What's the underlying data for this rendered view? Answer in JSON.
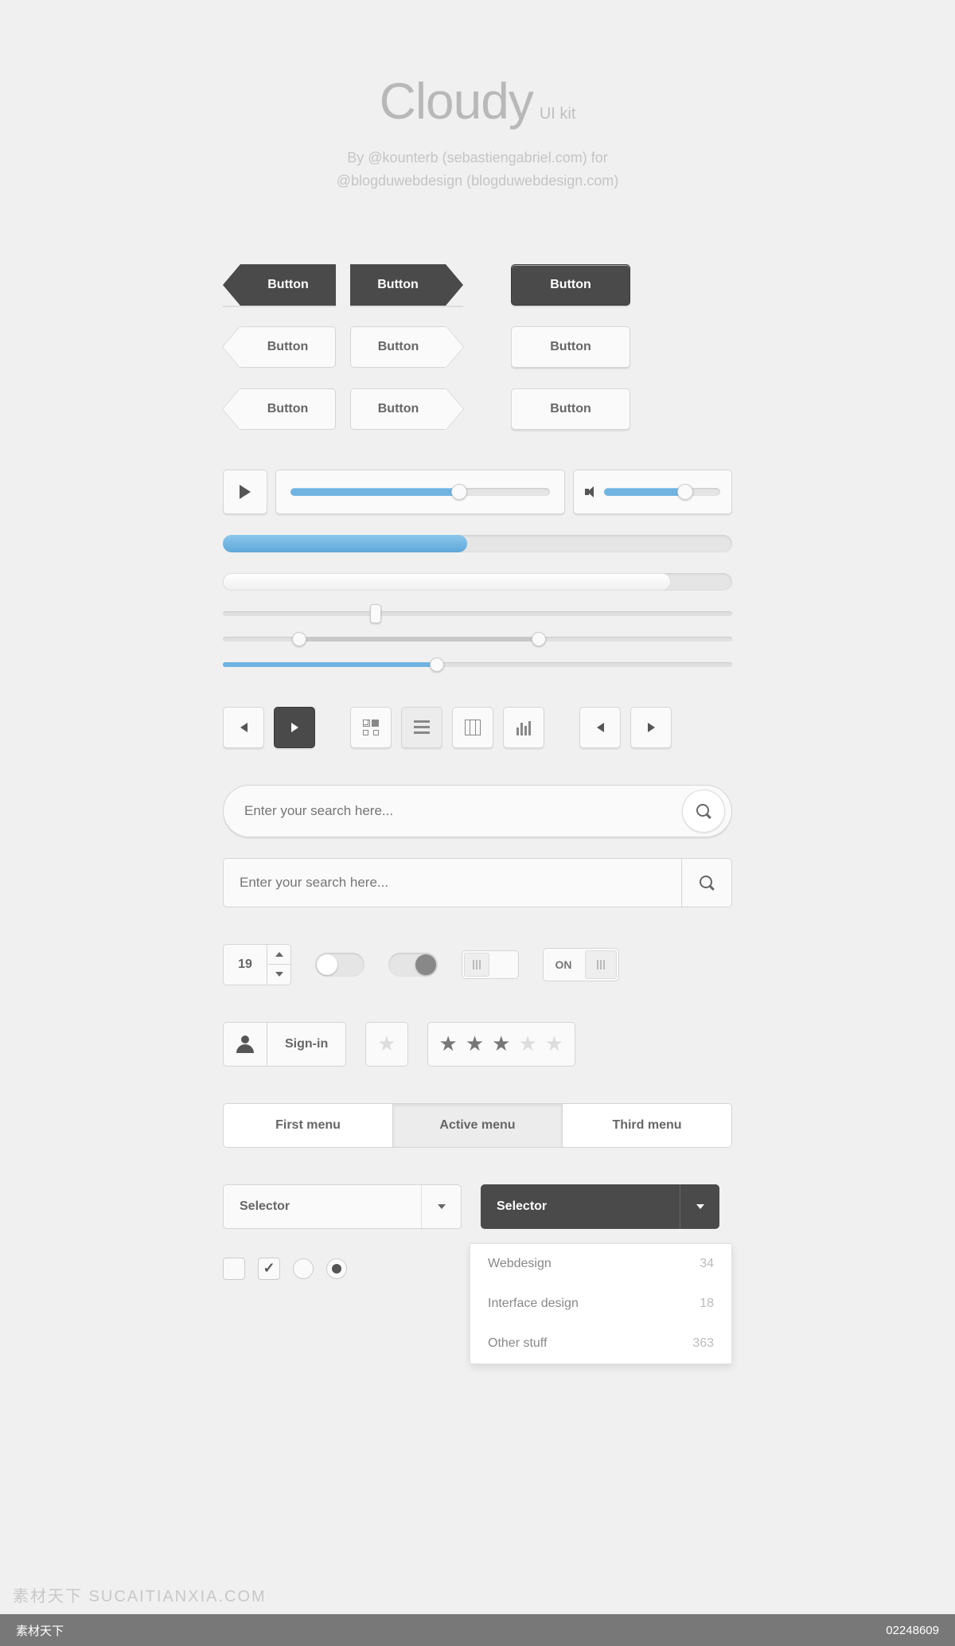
{
  "header": {
    "title": "Cloudy",
    "subtitle": "UI kit",
    "byline1": "By @kounterb (sebastiengabriel.com) for",
    "byline2": "@blogduwebdesign (blogduwebdesign.com)"
  },
  "buttons": {
    "dark_arrow_left": "Button",
    "dark_arrow_right": "Button",
    "dark_std": "Button",
    "light_arrow_left_1": "Button",
    "light_arrow_right_1": "Button",
    "light_std_1": "Button",
    "light_arrow_left_2": "Button",
    "light_arrow_right_2": "Button",
    "light_std_2": "Button"
  },
  "player": {
    "seek_percent": 65,
    "volume_percent": 70
  },
  "progress": {
    "blue_percent": 48,
    "white_percent": 88
  },
  "sliders": {
    "s1": 30,
    "range_a": 15,
    "range_b": 62,
    "s3": 42
  },
  "search": {
    "placeholder_round": "Enter your search here...",
    "placeholder_rect": "Enter your search here..."
  },
  "stepper": {
    "value": "19"
  },
  "switch_label": {
    "on": "ON"
  },
  "signin": {
    "label": "Sign-in"
  },
  "rating": {
    "stars_filled": 3,
    "stars_total": 5
  },
  "tabs": {
    "t1": "First menu",
    "t2": "Active menu",
    "t3": "Third menu"
  },
  "selectors": {
    "light": "Selector",
    "dark": "Selector"
  },
  "dropdown": {
    "items": [
      {
        "label": "Webdesign",
        "count": "34"
      },
      {
        "label": "Interface design",
        "count": "18"
      },
      {
        "label": "Other stuff",
        "count": "363"
      }
    ]
  },
  "footer": {
    "left": "素材天下",
    "right": "02248609"
  },
  "watermark": "素材天下  SUCAITIANXIA.COM"
}
